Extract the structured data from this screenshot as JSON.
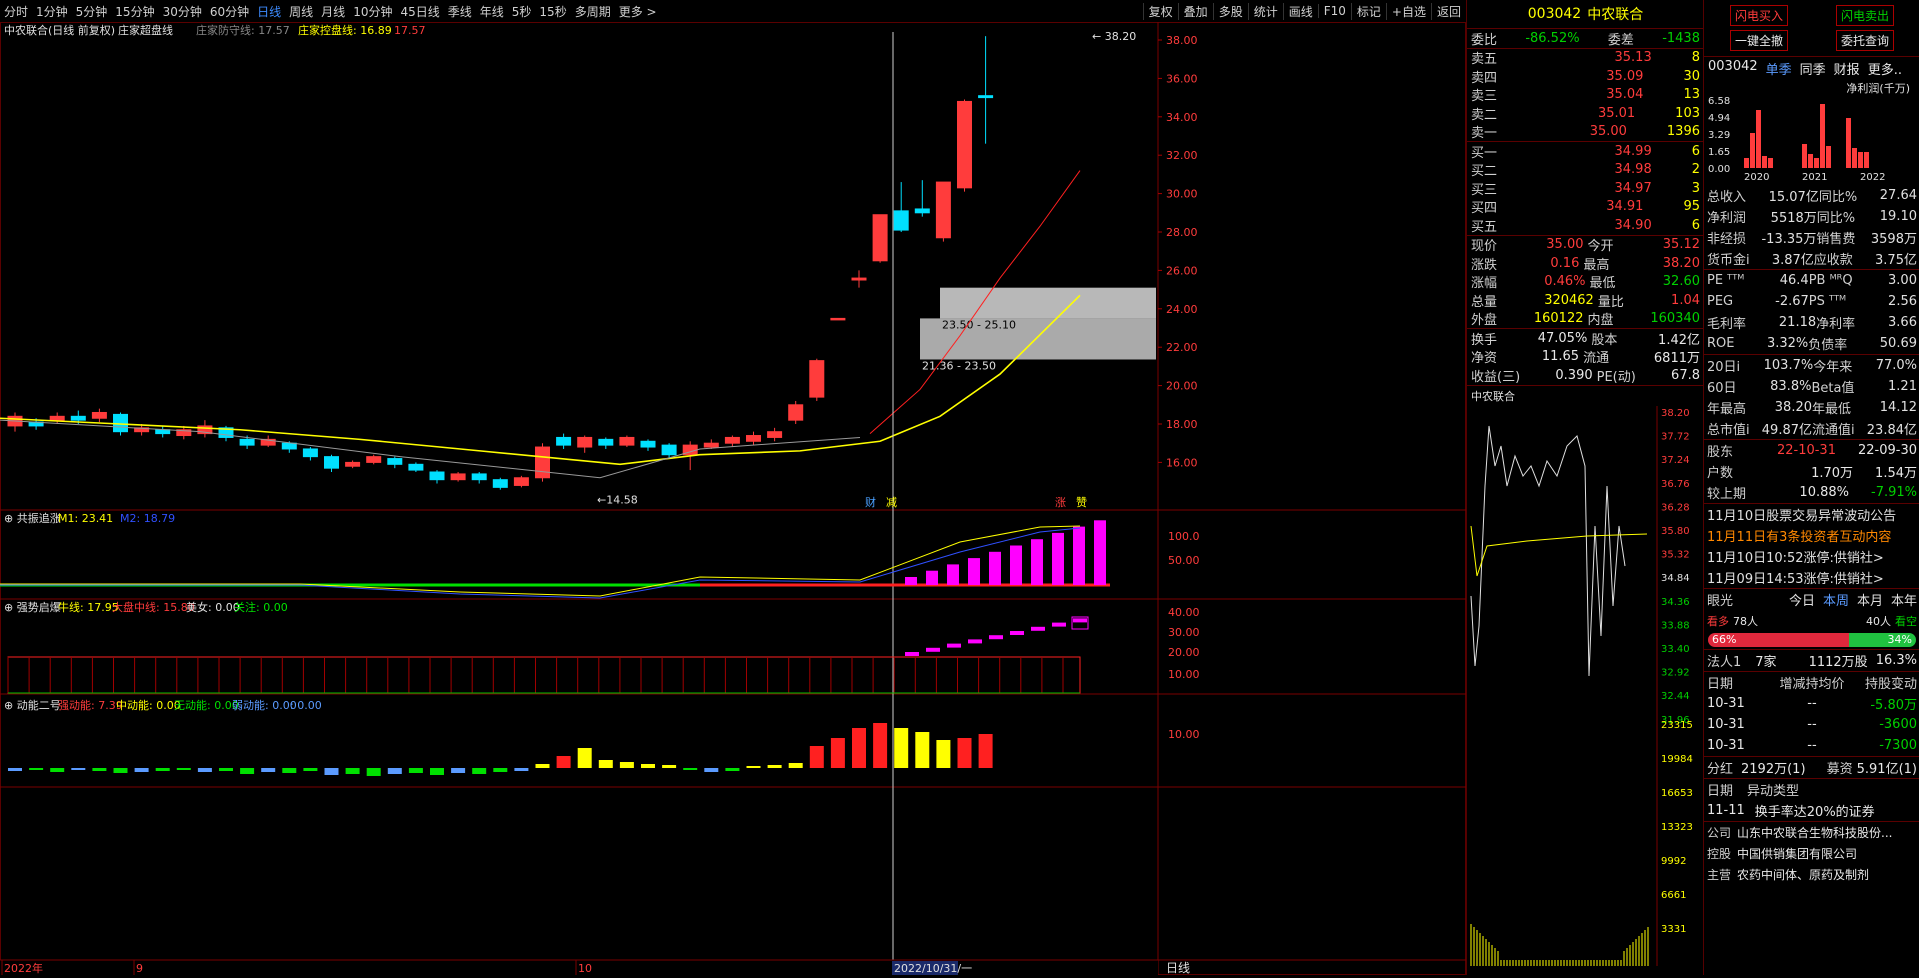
{
  "toolbar": {
    "timeframes": [
      "分时",
      "1分钟",
      "5分钟",
      "15分钟",
      "30分钟",
      "60分钟",
      "日线",
      "周线",
      "月线",
      "10分钟",
      "45日线",
      "季线",
      "年线",
      "5秒",
      "15秒",
      "多周期",
      "更多 >"
    ],
    "active": "日线",
    "tools": [
      "复权",
      "叠加",
      "多股",
      "统计",
      "画线",
      "F10",
      "标记",
      "+自选",
      "返回"
    ]
  },
  "main_panel": {
    "title": "中农联合(日线 前复权)",
    "indicator": "庄家超盘线",
    "ind1_label": "庄家防守线: 17.57",
    "ind2_label": "庄家控盘线: 16.89",
    "ind2_value": "17.57",
    "price_axis": [
      "38.00",
      "36.00",
      "34.00",
      "32.00",
      "30.00",
      "28.00",
      "26.00",
      "24.00",
      "22.00",
      "20.00",
      "18.00",
      "16.00"
    ],
    "high_label": "38.20",
    "low_label": "14.58",
    "zone1_label": "21.36 - 23.50",
    "zone2_label": "23.50 - 25.10",
    "markers": [
      "财",
      "减",
      "涨",
      "赞"
    ],
    "dates": [
      "2022年",
      "9",
      "10",
      "2022/10/31/一"
    ]
  },
  "panel2": {
    "name": "共振追涨",
    "m1": "M1: 23.41",
    "m2": "M2: 18.79",
    "axis": [
      "100.0",
      "50.00"
    ]
  },
  "panel3": {
    "name": "强势启爆",
    "niu": "牛线: 17.95",
    "dapan": "大盘中线: 15.80",
    "meinv": "美女: 0.00",
    "guanzhu": "关注: 0.00",
    "axis": [
      "40.00",
      "30.00",
      "20.00",
      "10.00"
    ]
  },
  "panel4": {
    "name": "动能二号",
    "qiang": "强动能: 7.39",
    "zhong": "中动能: 0.00",
    "wu": "无动能: 0.00",
    "ruo": "弱动能: 0.00",
    "extra": ": 0.00",
    "axis": [
      "10.00"
    ]
  },
  "bottom_tab": "日线",
  "quote": {
    "code": "003042",
    "name": "中农联合",
    "weibi_label": "委比",
    "weibi": "-86.52%",
    "weicha_label": "委差",
    "weicha": "-1438",
    "asks": [
      [
        "卖五",
        "35.13",
        "8"
      ],
      [
        "卖四",
        "35.09",
        "30"
      ],
      [
        "卖三",
        "35.04",
        "13"
      ],
      [
        "卖二",
        "35.01",
        "103"
      ],
      [
        "卖一",
        "35.00",
        "1396"
      ]
    ],
    "bids": [
      [
        "买一",
        "34.99",
        "6"
      ],
      [
        "买二",
        "34.98",
        "2"
      ],
      [
        "买三",
        "34.97",
        "3"
      ],
      [
        "买四",
        "34.91",
        "95"
      ],
      [
        "买五",
        "34.90",
        "6"
      ]
    ],
    "stats": [
      [
        "现价",
        "35.00",
        "今开",
        "35.12"
      ],
      [
        "涨跌",
        "0.16",
        "最高",
        "38.20"
      ],
      [
        "涨幅",
        "0.46%",
        "最低",
        "32.60"
      ],
      [
        "总量",
        "320462",
        "量比",
        "1.04"
      ],
      [
        "外盘",
        "160122",
        "内盘",
        "160340"
      ]
    ],
    "stats2": [
      [
        "换手",
        "47.05%",
        "股本",
        "1.42亿"
      ],
      [
        "净资",
        "11.65",
        "流通",
        "6811万"
      ],
      [
        "收益(三)",
        "0.390",
        "PE(动)",
        "67.8"
      ]
    ],
    "mini_title": "中农联合",
    "mini_axis": [
      "38.20",
      "37.72",
      "37.24",
      "36.76",
      "36.28",
      "35.80",
      "35.32",
      "34.84",
      "34.36",
      "33.88",
      "33.40",
      "32.92",
      "32.44",
      "31.96",
      "23315",
      "19984",
      "16653",
      "13323",
      "9992",
      "6661",
      "3331"
    ]
  },
  "info": {
    "btn_buy": "闪电买入",
    "btn_sell": "闪电卖出",
    "btn_cancel": "一键全撤",
    "btn_query": "委托查询",
    "code": "003042",
    "tabs": [
      "单季",
      "同季",
      "财报",
      "更多.."
    ],
    "profit_label": "净利润(千万)",
    "bar_axis": [
      "6.58",
      "4.94",
      "3.29",
      "1.65",
      "0.00"
    ],
    "years": [
      "2020",
      "2021",
      "2022"
    ],
    "fin": [
      [
        "总收入",
        "15.07亿",
        "同比%",
        "27.64"
      ],
      [
        "净利润",
        "5518万",
        "同比%",
        "19.10"
      ],
      [
        "非经损",
        "-13.35万",
        "销售费",
        "3598万"
      ],
      [
        "货币金i",
        "3.87亿",
        "应收款",
        "3.75亿"
      ]
    ],
    "val": [
      [
        "PE ᵀᵀᴹ",
        "46.4",
        "PB ᴹᴿQ",
        "3.00"
      ],
      [
        "PEG",
        "-2.67",
        "PS ᵀᵀᴹ",
        "2.56"
      ],
      [
        "毛利率",
        "21.18",
        "净利率",
        "3.66"
      ],
      [
        "ROE",
        "3.32%",
        "负债率",
        "50.69"
      ]
    ],
    "perf": [
      [
        "20日i",
        "103.7%",
        "今年来",
        "77.0%"
      ],
      [
        "60日",
        "83.8%",
        "Beta值",
        "1.21"
      ],
      [
        "年最高",
        "38.20",
        "年最低",
        "14.12"
      ],
      [
        "总市值i",
        "49.87亿",
        "流通值i",
        "23.84亿"
      ]
    ],
    "holders_label": "股东",
    "holders_d1": "22-10-31",
    "holders_d2": "22-09-30",
    "holders": [
      [
        "户数",
        "1.70万",
        "1.54万"
      ],
      [
        "较上期",
        "10.88%",
        "-7.91%"
      ]
    ],
    "news": [
      "11月10日股票交易异常波动公告",
      "11月11日有3条投资者互动内容",
      "11月10日10:52涨停:供销社>",
      "11月09日14:53涨停:供销社>"
    ],
    "yanguang": "眼光",
    "yg_tabs": [
      "今日",
      "本周",
      "本月",
      "本年"
    ],
    "bull": "看多",
    "bull_n": "78人",
    "bear_n": "40人",
    "bear": "看空",
    "bull_pct": "66%",
    "bear_pct": "34%",
    "legal": "法人1",
    "legal_n": "7家",
    "legal_v": "1112万股",
    "legal_pct": "16.3%",
    "hold_head": [
      "日期",
      "增减持均价",
      "持股变动"
    ],
    "hold_rows": [
      [
        "10-31",
        "--",
        "-5.80万"
      ],
      [
        "10-31",
        "--",
        "-3600"
      ],
      [
        "10-31",
        "--",
        "-7300"
      ]
    ],
    "fenhong": "分红",
    "fenhong_v": "2192万(1)",
    "muzi": "募资",
    "muzi_v": "5.91亿(1)",
    "yd_head": [
      "日期",
      "异动类型"
    ],
    "yd_row": [
      "11-11",
      "换手率达20%的证券"
    ],
    "company": [
      [
        "公司",
        "山东中农联合生物科技股份..."
      ],
      [
        "控股",
        "中国供销集团有限公司"
      ],
      [
        "主营",
        "农药中间体、原药及制剂"
      ]
    ]
  }
}
